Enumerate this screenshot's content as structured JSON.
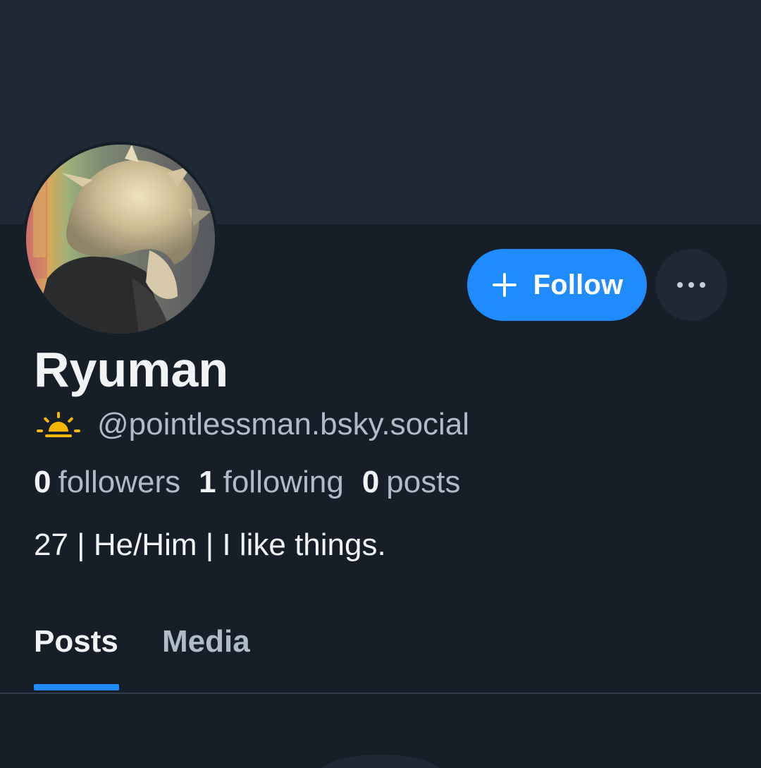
{
  "profile": {
    "display_name": "Ryuman",
    "handle": "@pointlessman.bsky.social",
    "status_icon": "sun-rising-icon",
    "bio": "27 | He/Him | I like things.",
    "avatar": "profile-avatar-image"
  },
  "actions": {
    "follow_label": "Follow",
    "more_icon": "ellipsis-icon"
  },
  "stats": {
    "followers_count": "0",
    "followers_label": "followers",
    "following_count": "1",
    "following_label": "following",
    "posts_count": "0",
    "posts_label": "posts"
  },
  "tabs": {
    "items": [
      {
        "label": "Posts",
        "active": true
      },
      {
        "label": "Media",
        "active": false
      }
    ]
  },
  "colors": {
    "accent": "#208bfe",
    "background": "#161e27",
    "banner": "#1e2935",
    "sun": "#f5b800"
  }
}
